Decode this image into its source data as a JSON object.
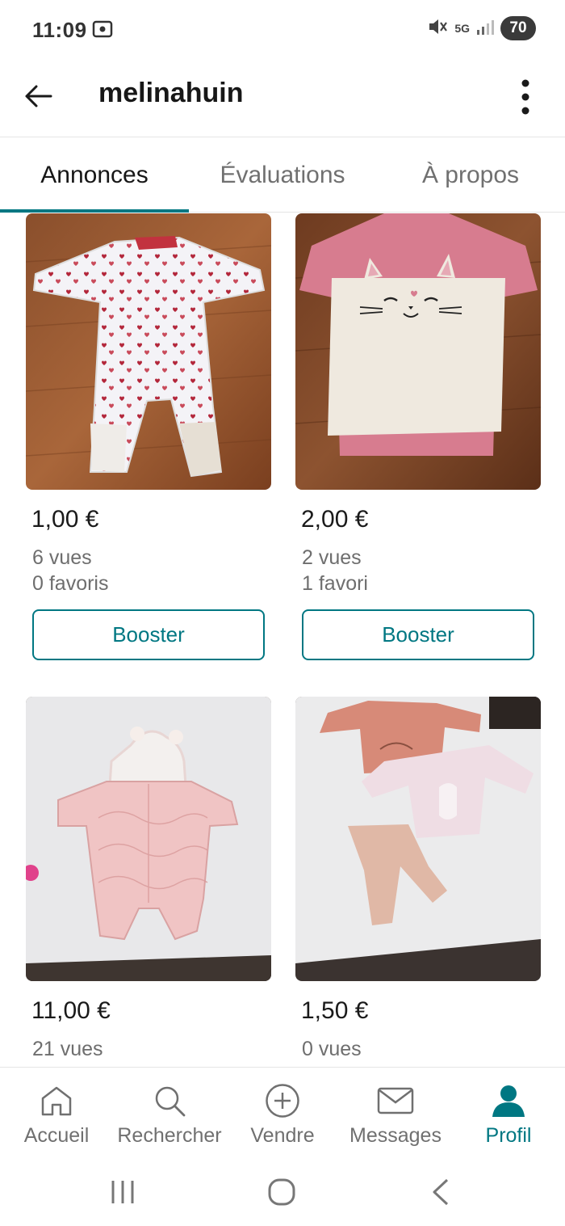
{
  "status_bar": {
    "time": "11:09",
    "network": "5G",
    "battery": "70"
  },
  "header": {
    "title": "melinahuin"
  },
  "tabs": [
    {
      "label": "Annonces",
      "active": true
    },
    {
      "label": "Évaluations",
      "active": false
    },
    {
      "label": "À propos",
      "active": false
    }
  ],
  "items": [
    {
      "photo": "white-sleepsuit-with-red-hearts",
      "price": "1,00 €",
      "views": "6 vues",
      "favorites": "0 favoris",
      "action": "Booster"
    },
    {
      "photo": "pink-and-white-cat-sweater-dress",
      "price": "2,00 €",
      "views": "2 vues",
      "favorites": "1 favori",
      "action": "Booster"
    },
    {
      "photo": "pink-quilted-snowsuit",
      "price": "11,00 €",
      "views": "21 vues",
      "favorites": ""
    },
    {
      "photo": "baby-clothes-set-bodysuits-and-leggings",
      "price": "1,50 €",
      "views": "0 vues",
      "favorites": ""
    }
  ],
  "bottom_nav": [
    {
      "label": "Accueil",
      "icon": "home-icon"
    },
    {
      "label": "Rechercher",
      "icon": "search-icon"
    },
    {
      "label": "Vendre",
      "icon": "plus-circle-icon"
    },
    {
      "label": "Messages",
      "icon": "envelope-icon"
    },
    {
      "label": "Profil",
      "icon": "profile-icon",
      "active": true
    }
  ],
  "colors": {
    "accent": "#007782",
    "text_primary": "#1a1a1a",
    "text_secondary": "#6e6e6e"
  }
}
